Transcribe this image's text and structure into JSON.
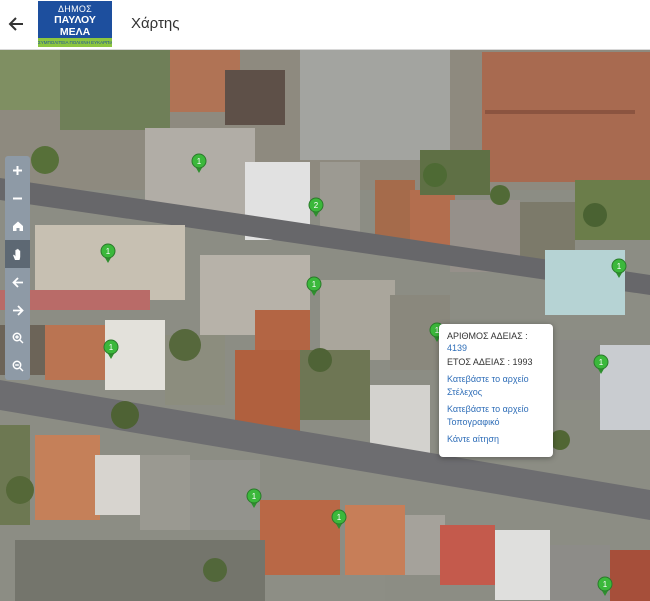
{
  "header": {
    "back_icon": "arrow-left-icon",
    "logo": {
      "line1": "ΔΗΜΟΣ",
      "line2": "ΠΑΥΛΟΥ ΜΕΛΑ",
      "line3": "ΣΥΜΠΟΛΙΤΕΙΑ ΠΟΛΙΧΝΗ ΕΥΚΑΡΠΙΑ"
    },
    "title": "Χάρτης"
  },
  "map_tools": [
    {
      "name": "zoom-in-button",
      "icon": "plus-icon",
      "glyph": "+"
    },
    {
      "name": "zoom-out-button",
      "icon": "minus-icon",
      "glyph": "−"
    },
    {
      "name": "home-button",
      "icon": "home-icon",
      "glyph": "⌂"
    },
    {
      "name": "pan-button",
      "icon": "hand-icon",
      "glyph": "✋",
      "active": true
    },
    {
      "name": "previous-extent-button",
      "icon": "arrow-left-icon",
      "glyph": "←"
    },
    {
      "name": "next-extent-button",
      "icon": "arrow-right-icon",
      "glyph": "→"
    },
    {
      "name": "zoom-in-box-button",
      "icon": "zoom-in-icon",
      "glyph": "⊕"
    },
    {
      "name": "zoom-out-box-button",
      "icon": "zoom-out-icon",
      "glyph": "⊖"
    }
  ],
  "markers": [
    {
      "label": "1"
    },
    {
      "label": "2"
    },
    {
      "label": "1"
    },
    {
      "label": "1"
    },
    {
      "label": "1"
    },
    {
      "label": "1"
    },
    {
      "label": "1"
    },
    {
      "label": "1"
    },
    {
      "label": "1"
    },
    {
      "label": "1"
    },
    {
      "label": "1"
    }
  ],
  "popup": {
    "permit_label": "ΑΡΙΘΜΟΣ ΑΔΕΙΑΣ :",
    "permit_number": "4139",
    "year_text": "ΕΤΟΣ ΑΔΕΙΑΣ : 1993",
    "download_frame_line1": "Κατεβάστε το αρχείο",
    "download_frame_line2": "Στέλεχος",
    "download_topo_line1": "Κατεβάστε το αρχείο",
    "download_topo_line2": "Τοπογραφικό",
    "apply_link": "Κάντε αίτηση"
  },
  "colors": {
    "marker": "#3bb83b",
    "link": "#2f6eb8",
    "toolbar": "#8e9aa6",
    "logo_blue": "#1d4f9e",
    "logo_green": "#8cc63f"
  }
}
